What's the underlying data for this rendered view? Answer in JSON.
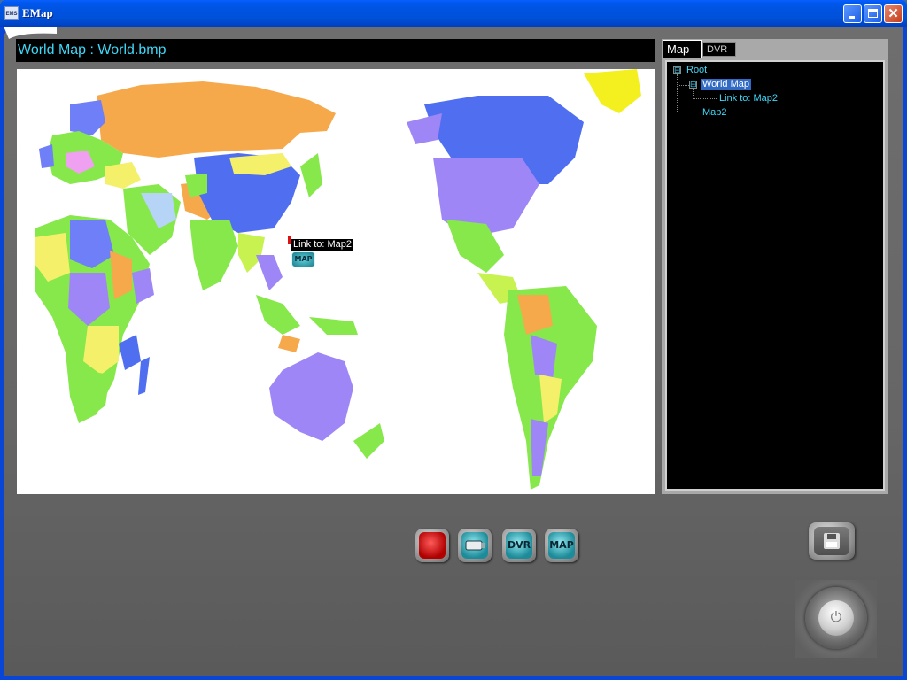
{
  "window": {
    "title": "EMap",
    "icon_label": "EMS",
    "controls": {
      "minimize": "minimize-icon",
      "maximize": "maximize-icon",
      "close": "✕"
    }
  },
  "map_view": {
    "title": "World Map : World.bmp",
    "link_label": "Link to: Map2",
    "link_icon_label": "MAP"
  },
  "panel": {
    "tabs": [
      {
        "label": "Map",
        "active": true
      },
      {
        "label": "DVR",
        "active": false
      }
    ],
    "tree": {
      "root": "Root",
      "expanders": [
        "⊟",
        "⊟"
      ],
      "world_map": "World Map",
      "link": "Link to: Map2",
      "map2": "Map2"
    }
  },
  "toolbar": {
    "buttons": [
      {
        "name": "alarm-button",
        "icon": "alarm-icon",
        "label": ""
      },
      {
        "name": "camera-button",
        "icon": "camera-icon",
        "label": ""
      },
      {
        "name": "dvr-button",
        "icon": "dvr-icon",
        "label": "DVR"
      },
      {
        "name": "map-button",
        "icon": "map-icon",
        "label": "MAP"
      }
    ],
    "save_icon": "save-icon",
    "power_icon": "power-icon",
    "power_glyph": "⏻"
  },
  "colors": {
    "title_text": "#3fd7f7",
    "titlebar": "#0054e3",
    "selected": "#316ac5"
  }
}
